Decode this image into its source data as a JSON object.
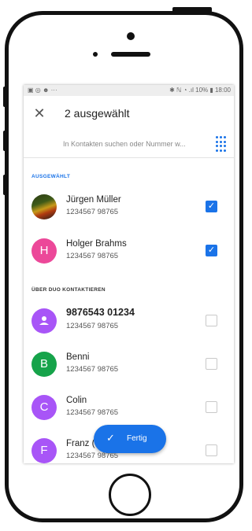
{
  "status_bar": {
    "left_icons": "▣ ◎ ☻ ···",
    "right_text": "✱ ℕ ◔ .ıl 10% ▮ 18:00"
  },
  "app_bar": {
    "title": "2 ausgewählt"
  },
  "search": {
    "placeholder": "In Kontakten suchen oder Nummer w..."
  },
  "sections": {
    "selected": "AUSGEWÄHLT",
    "over_duo": "ÜBER DUO KONTAKTIEREN"
  },
  "selected_contacts": [
    {
      "name": "Jürgen Müller",
      "number": "1234567 98765",
      "avatar": "photo",
      "checked": true
    },
    {
      "name": "Holger Brahms",
      "number": "1234567 98765",
      "initial": "H",
      "color": "#ec4899",
      "checked": true
    }
  ],
  "duo_contacts": [
    {
      "name": "9876543 01234",
      "number": "1234567 98765",
      "icon": "person-icon",
      "color": "#a855f7",
      "checked": false
    },
    {
      "name": "Benni",
      "number": "1234567 98765",
      "initial": "B",
      "color": "#16a34a",
      "checked": false
    },
    {
      "name": "Colin",
      "number": "1234567 98765",
      "initial": "C",
      "color": "#a855f7",
      "checked": false
    },
    {
      "name": "Franz (",
      "number": "1234567 98765",
      "initial": "F",
      "color": "#a855f7",
      "checked": false
    }
  ],
  "fab": {
    "label": "Fertig"
  }
}
